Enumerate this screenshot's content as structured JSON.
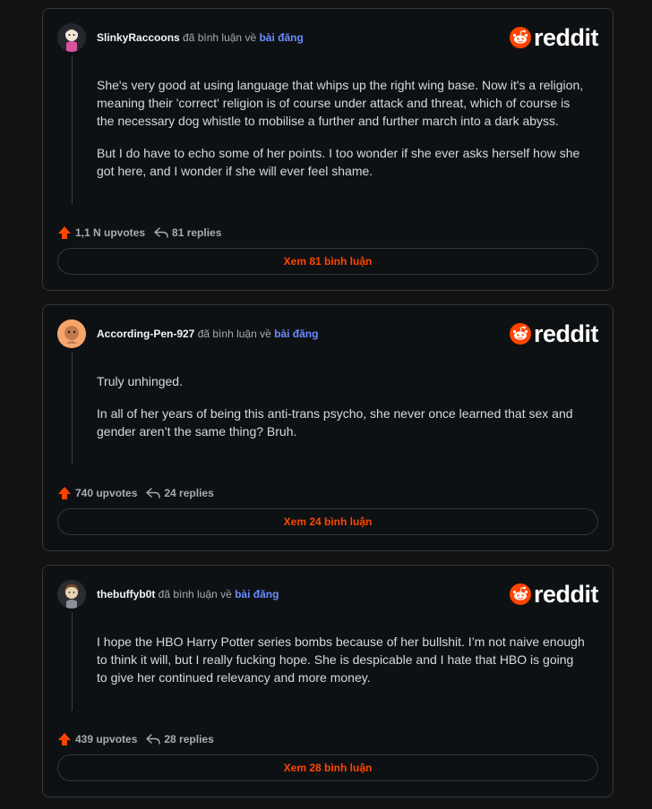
{
  "colors": {
    "background": "#121212",
    "card": "#0e1114",
    "accent_orange": "#ff4500",
    "link_blue": "#6a8cff"
  },
  "brand": {
    "wordmark": "reddit",
    "icon": "reddit-snoo-icon"
  },
  "comments": [
    {
      "username": "SlinkyRaccoons",
      "commented_on": "đã bình luận về",
      "post_link": "bài đăng",
      "paragraphs": [
        "She's very good at using language that whips up the right wing base. Now it's a religion, meaning their 'correct' religion is of course under attack and threat, which of course is the necessary dog whistle to mobilise a further and further march into a dark abyss.",
        "But I do have to echo some of her points. I too wonder if she ever asks herself how she got here, and I wonder if she will ever feel shame."
      ],
      "upvotes": "1,1 N upvotes",
      "replies": "81 replies",
      "view_button": "Xem 81 bình luận"
    },
    {
      "username": "According-Pen-927",
      "commented_on": "đã bình luận về",
      "post_link": "bài đăng",
      "paragraphs": [
        "Truly unhinged.",
        "In all of her years of being this anti-trans psycho, she never once learned that sex and gender aren’t the same thing? Bruh."
      ],
      "upvotes": "740 upvotes",
      "replies": "24 replies",
      "view_button": "Xem 24 bình luận"
    },
    {
      "username": "thebuffyb0t",
      "commented_on": "đã bình luận về",
      "post_link": "bài đăng",
      "paragraphs": [
        "I hope the HBO Harry Potter series bombs because of her bullshit. I’m not naive enough to think it will, but I really fucking hope. She is despicable and I hate that HBO is going to give her continued relevancy and more money."
      ],
      "upvotes": "439 upvotes",
      "replies": "28 replies",
      "view_button": "Xem 28 bình luận"
    }
  ]
}
